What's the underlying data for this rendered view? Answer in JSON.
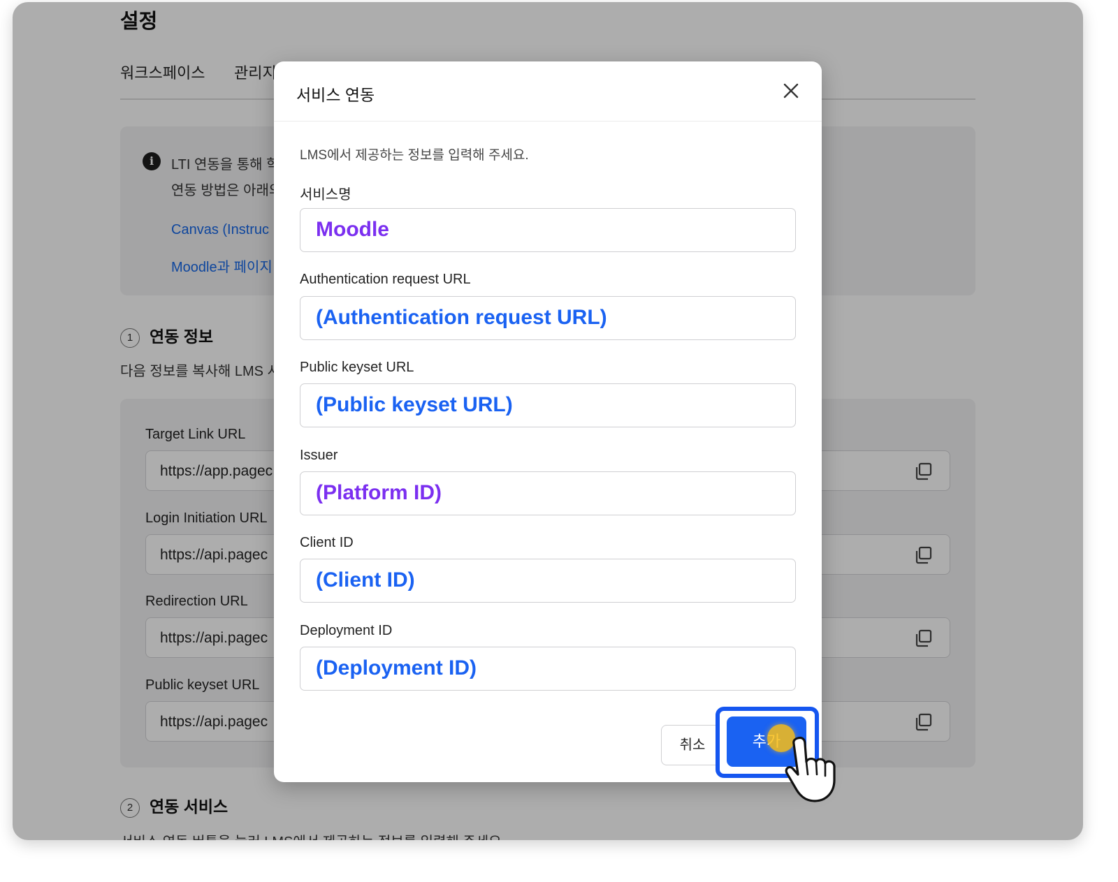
{
  "page": {
    "title": "설정"
  },
  "tabs": [
    {
      "label": "워크스페이스"
    },
    {
      "label": "관리지"
    }
  ],
  "info_box": {
    "line1": "LTI 연동을 통해 학",
    "line2": "연동 방법은 아래의",
    "link1": "Canvas (Instruc",
    "link2": "Moodle과 페이지"
  },
  "section1": {
    "number": "1",
    "title": "연동 정보",
    "description": "다음 정보를 복사해 LMS 시"
  },
  "url_panel": {
    "fields": [
      {
        "label": "Target Link URL",
        "value": "https://app.pagec"
      },
      {
        "label": "Login Initiation URL",
        "value": "https://api.pagec"
      },
      {
        "label": "Redirection URL",
        "value": "https://api.pagec"
      },
      {
        "label": "Public keyset URL",
        "value": "https://api.pagec"
      }
    ]
  },
  "section2": {
    "number": "2",
    "title": "연동 서비스",
    "description": "서비스 연동 버튼을 눌러 LMS에서 제공하는 정보를 입력해 주세요."
  },
  "modal": {
    "title": "서비스 연동",
    "description": "LMS에서 제공하는 정보를 입력해 주세요.",
    "fields": [
      {
        "label": "서비스명",
        "value": "Moodle",
        "color": "#7b2ff0"
      },
      {
        "label": "Authentication request URL",
        "value": "(Authentication request URL)",
        "color": "#1a62f2"
      },
      {
        "label": "Public keyset URL",
        "value": "(Public keyset URL)",
        "color": "#1a62f2"
      },
      {
        "label": "Issuer",
        "value": "(Platform ID)",
        "color": "#7b2ff0"
      },
      {
        "label": "Client ID",
        "value": "(Client ID)",
        "color": "#1a62f2"
      },
      {
        "label": "Deployment ID",
        "value": "(Deployment ID)",
        "color": "#1a62f2"
      }
    ],
    "cancel_label": "취소",
    "add_label": "추가"
  },
  "icons": {
    "info": "info-icon",
    "close": "close-icon",
    "copy": "copy-icon",
    "cursor": "hand-pointer-icon"
  },
  "colors": {
    "primary": "#1a62f2",
    "highlight_purple": "#7b2ff0",
    "link": "#1667e8"
  }
}
